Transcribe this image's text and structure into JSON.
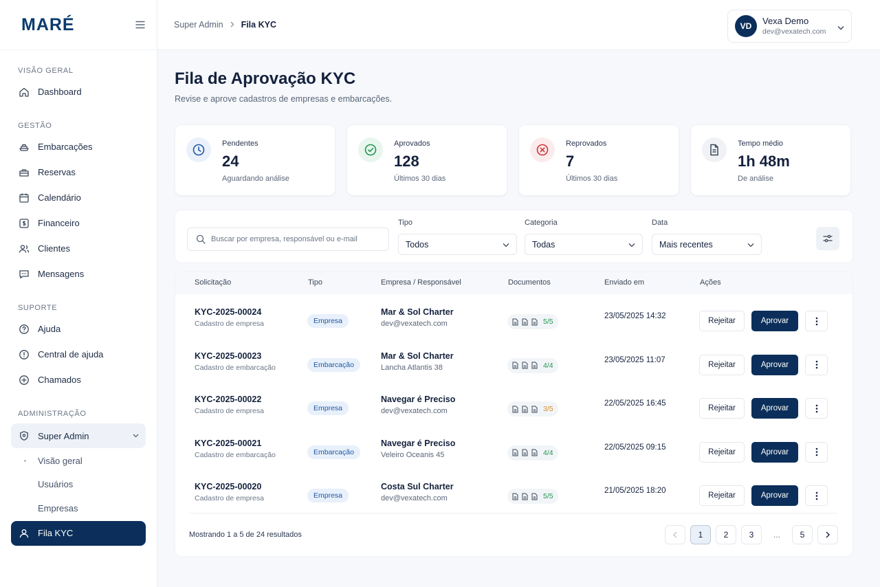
{
  "brand": {
    "logo": "MARÉ"
  },
  "sidebar": {
    "sections": [
      {
        "label": "VISÃO GERAL",
        "items": [
          {
            "label": "Dashboard",
            "icon": "home-icon"
          }
        ]
      },
      {
        "label": "GESTÃO",
        "items": [
          {
            "label": "Embarcações",
            "icon": "boat-icon"
          },
          {
            "label": "Reservas",
            "icon": "briefcase-icon"
          },
          {
            "label": "Calendário",
            "icon": "calendar-icon"
          },
          {
            "label": "Financeiro",
            "icon": "dollar-icon"
          },
          {
            "label": "Clientes",
            "icon": "users-icon"
          },
          {
            "label": "Mensagens",
            "icon": "chat-icon"
          }
        ]
      },
      {
        "label": "SUPORTE",
        "items": [
          {
            "label": "Ajuda",
            "icon": "help-circle-icon"
          },
          {
            "label": "Central de ajuda",
            "icon": "info-circle-icon"
          },
          {
            "label": "Chamados",
            "icon": "ticket-icon"
          }
        ]
      },
      {
        "label": "ADMINISTRAÇÃO",
        "items": [
          {
            "label": "Super Admin",
            "icon": "shield-icon"
          }
        ]
      }
    ],
    "submenu": [
      "Visão geral",
      "Usuários",
      "Empresas"
    ],
    "active_item": "Fila KYC"
  },
  "topbar": {
    "breadcrumb": [
      "Super Admin",
      "Fila KYC"
    ],
    "user": {
      "initials": "VD",
      "name": "Vexa Demo",
      "email": "dev@vexatech.com"
    }
  },
  "page": {
    "title": "Fila de Aprovação KYC",
    "subtitle": "Revise e aprove cadastros de empresas e embarcações."
  },
  "stats": [
    {
      "label": "Pendentes",
      "value": "24",
      "sub": "Aguardando análise",
      "icon": "clock-icon",
      "color": "#1f57a3",
      "bg": "#eaf1fb"
    },
    {
      "label": "Aprovados",
      "value": "128",
      "sub": "Últimos 30 dias",
      "icon": "check-circle-icon",
      "color": "#23944f",
      "bg": "#e8f6ee"
    },
    {
      "label": "Reprovados",
      "value": "7",
      "sub": "Últimos 30 dias",
      "icon": "x-circle-icon",
      "color": "#d0353b",
      "bg": "#fcebec"
    },
    {
      "label": "Tempo médio",
      "value": "1h 48m",
      "sub": "De análise",
      "icon": "document-icon",
      "color": "#3b4758",
      "bg": "#f0f2f6"
    }
  ],
  "filters": {
    "search_placeholder": "Buscar por empresa, responsável ou e-mail",
    "tipo": {
      "label": "Tipo",
      "value": "Todos"
    },
    "categoria": {
      "label": "Categoria",
      "value": "Todas"
    },
    "data": {
      "label": "Data",
      "value": "Mais recentes"
    }
  },
  "table": {
    "headers": [
      "Solicitação",
      "Tipo",
      "Empresa / Responsável",
      "Documentos",
      "Enviado em",
      "Ações"
    ],
    "rows": [
      {
        "id": "KYC-2025-00024",
        "sub": "Cadastro de empresa",
        "tipo": "Empresa",
        "company": "Mar & Sol Charter",
        "contact": "dev@vexatech.com",
        "docs": "5/5",
        "docs_status": "ok",
        "sent": "23/05/2025 14:32"
      },
      {
        "id": "KYC-2025-00023",
        "sub": "Cadastro de embarcação",
        "tipo": "Embarcação",
        "company": "Mar & Sol Charter",
        "contact": "Lancha Atlantis 38",
        "docs": "4/4",
        "docs_status": "ok",
        "sent": "23/05/2025 11:07"
      },
      {
        "id": "KYC-2025-00022",
        "sub": "Cadastro de empresa",
        "tipo": "Empresa",
        "company": "Navegar é Preciso",
        "contact": "dev@vexatech.com",
        "docs": "3/5",
        "docs_status": "warn",
        "sent": "22/05/2025 16:45"
      },
      {
        "id": "KYC-2025-00021",
        "sub": "Cadastro de embarcação",
        "tipo": "Embarcação",
        "company": "Navegar é Preciso",
        "contact": "Veleiro Oceanis 45",
        "docs": "4/4",
        "docs_status": "ok",
        "sent": "22/05/2025 09:15"
      },
      {
        "id": "KYC-2025-00020",
        "sub": "Cadastro de empresa",
        "tipo": "Empresa",
        "company": "Costa Sul Charter",
        "contact": "dev@vexatech.com",
        "docs": "5/5",
        "docs_status": "ok",
        "sent": "21/05/2025 18:20"
      }
    ],
    "reject_label": "Rejeitar",
    "approve_label": "Aprovar"
  },
  "pagination": {
    "summary": "Mostrando 1 a 5 de 24 resultados",
    "pages": [
      "1",
      "2",
      "3",
      "...",
      "5"
    ],
    "current": "1"
  }
}
